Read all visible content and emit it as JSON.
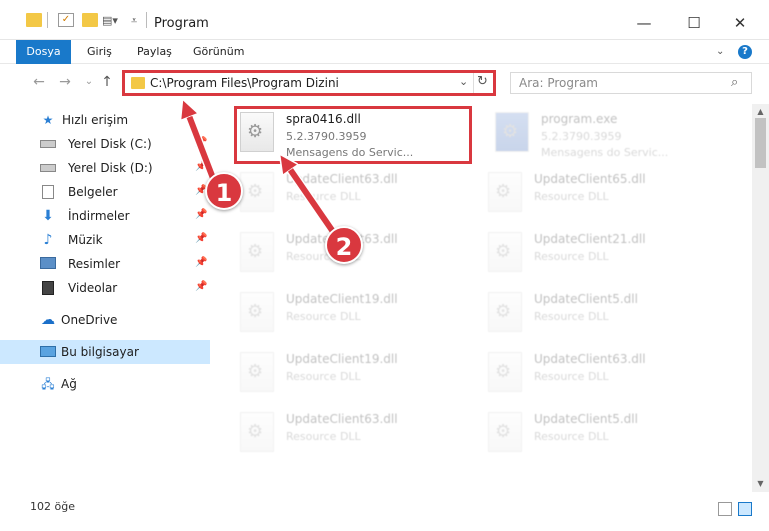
{
  "window": {
    "title": "Program",
    "minimize": "—",
    "maximize": "☐",
    "close": "✕"
  },
  "ribbon": {
    "tabs": [
      "Dosya",
      "Giriş",
      "Paylaş",
      "Görünüm"
    ],
    "help": "?"
  },
  "nav": {
    "back": "←",
    "forward": "→",
    "recent": "⌄",
    "up": "↑"
  },
  "address": {
    "path": "C:\\Program Files\\Program Dizini",
    "dropdown": "⌄",
    "refresh": "↻"
  },
  "search": {
    "placeholder": "Ara: Program",
    "icon": "⌕"
  },
  "sidebar": {
    "quick_access": "Hızlı erişim",
    "items": [
      {
        "label": "Yerel Disk (C:)",
        "icon": "drive-icon"
      },
      {
        "label": "Yerel Disk (D:)",
        "icon": "drive-icon"
      },
      {
        "label": "Belgeler",
        "icon": "documents-icon"
      },
      {
        "label": "İndirmeler",
        "icon": "downloads-icon"
      },
      {
        "label": "Müzik",
        "icon": "music-icon"
      },
      {
        "label": "Resimler",
        "icon": "pictures-icon"
      },
      {
        "label": "Videolar",
        "icon": "videos-icon"
      }
    ],
    "onedrive": "OneDrive",
    "this_pc": "Bu bilgisayar",
    "network": "Ağ"
  },
  "files": [
    {
      "name": "spra0416.dll",
      "version": "5.2.3790.3959",
      "desc": "Mensagens do Servic..."
    },
    {
      "name": "program.exe",
      "version": "5.2.3790.3959",
      "desc": "Mensagens do Servic..."
    },
    {
      "name": "UpdateClient63.dll",
      "version": "Resource DLL",
      "desc": ""
    },
    {
      "name": "UpdateClient65.dll",
      "version": "Resource DLL",
      "desc": ""
    },
    {
      "name": "UpdateClient63.dll",
      "version": "Resource DLL",
      "desc": ""
    },
    {
      "name": "UpdateClient21.dll",
      "version": "Resource DLL",
      "desc": ""
    },
    {
      "name": "UpdateClient19.dll",
      "version": "Resource DLL",
      "desc": ""
    },
    {
      "name": "UpdateClient5.dll",
      "version": "Resource DLL",
      "desc": ""
    },
    {
      "name": "UpdateClient19.dll",
      "version": "Resource DLL",
      "desc": ""
    },
    {
      "name": "UpdateClient63.dll",
      "version": "Resource DLL",
      "desc": ""
    },
    {
      "name": "UpdateClient63.dll",
      "version": "Resource DLL",
      "desc": ""
    },
    {
      "name": "UpdateClient5.dll",
      "version": "Resource DLL",
      "desc": ""
    }
  ],
  "annotations": {
    "badge1": "1",
    "badge2": "2",
    "color": "#d9383f"
  },
  "status": {
    "count": "102 öğe"
  }
}
